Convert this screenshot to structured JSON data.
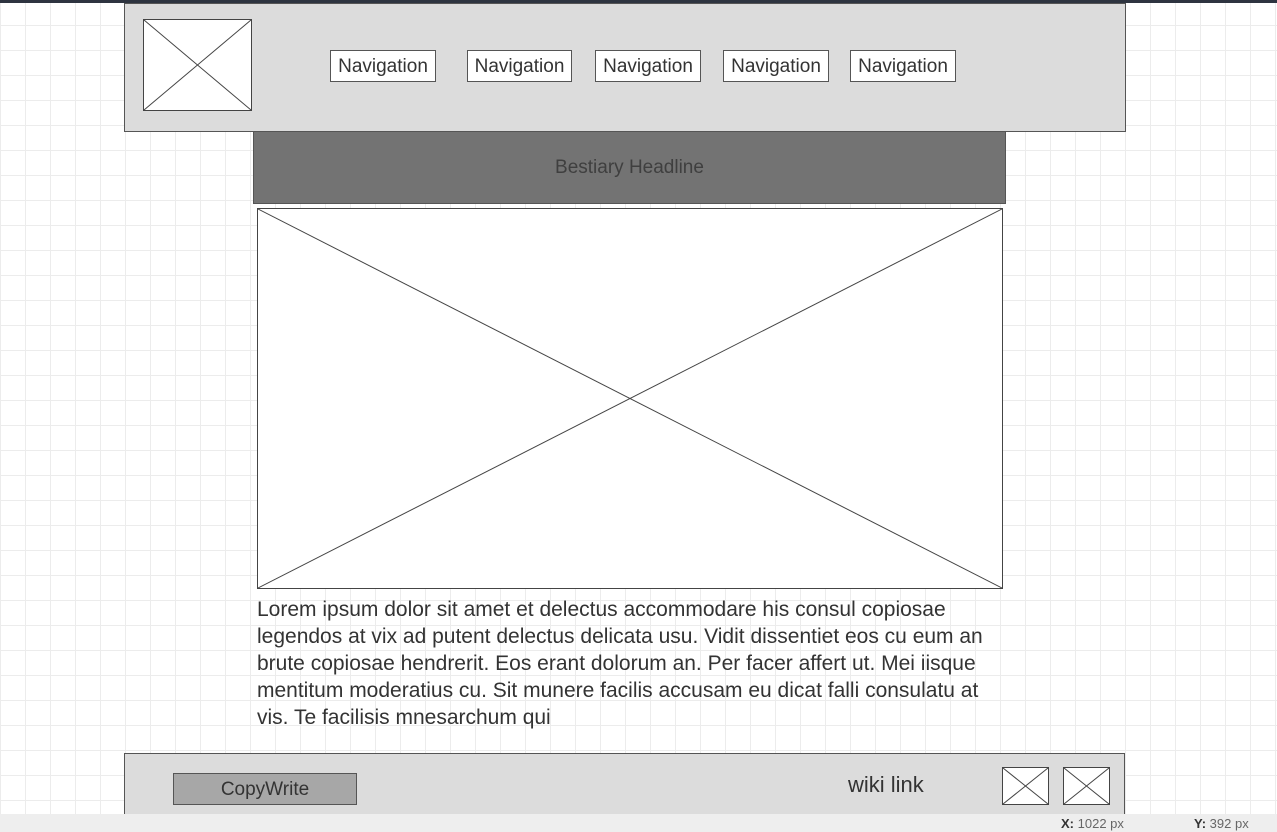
{
  "header": {
    "nav": [
      "Navigation",
      "Navigation",
      "Navigation",
      "Navigation",
      "Navigation"
    ]
  },
  "headline": "Bestiary Headline",
  "body_text": "Lorem ipsum dolor sit amet et delectus accommodare his consul copiosae legendos at vix ad putent delectus delicata usu. Vidit dissentiet eos cu eum an brute copiosae hendrerit. Eos erant dolorum an. Per facer affert ut. Mei iisque mentitum moderatius cu. Sit munere facilis accusam eu dicat falli consulatu at vis. Te facilisis mnesarchum qui",
  "footer": {
    "copywrite": "CopyWrite",
    "wiki_link": "wiki link"
  },
  "status": {
    "x_label": "X:",
    "x_value": "1022 px",
    "y_label": "Y:",
    "y_value": "392 px"
  },
  "colors": {
    "header_bg": "#dcdcdc",
    "headline_bg": "#737373",
    "button_bg": "#a7a7a7"
  }
}
